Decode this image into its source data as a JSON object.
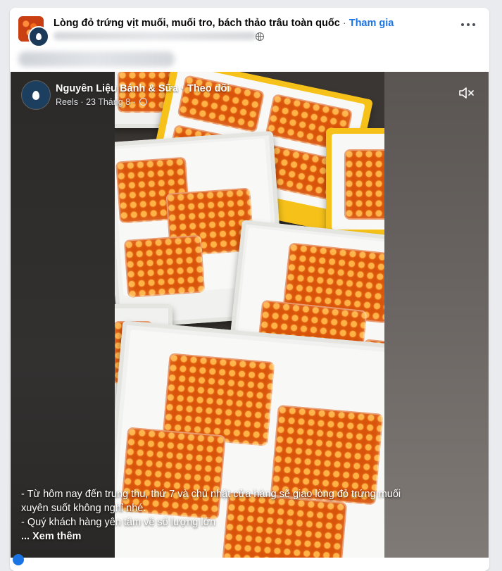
{
  "post": {
    "group_name": "Lòng đỏ trứng vịt muối, muối tro, bách thảo trâu toàn quốc",
    "separator": "·",
    "join_label": "Tham gia"
  },
  "video": {
    "channel_name": "Nguyên Liệu Bánh & Sữa",
    "separator": "·",
    "follow_label": "Theo dõi",
    "reel_meta": "Reels · 23 Tháng 8 ·",
    "caption_lines": [
      "- Từ hôm nay đến trung thu, thứ 7 và chủ nhật cửa hàng sẽ giao lòng đỏ trứng muối",
      "xuyên suốt không nghỉ nhé.",
      "- Quý khách hàng yên tâm về số lượng lớn"
    ],
    "see_more": "... Xem thêm"
  },
  "icons": {
    "more": "more-horizontal-icon",
    "globe": "globe-icon",
    "mute": "speaker-muted-icon"
  },
  "colors": {
    "link_blue": "#1b74e4",
    "egg_orange": "#e2620f",
    "box_yellow": "#f6c21a"
  }
}
